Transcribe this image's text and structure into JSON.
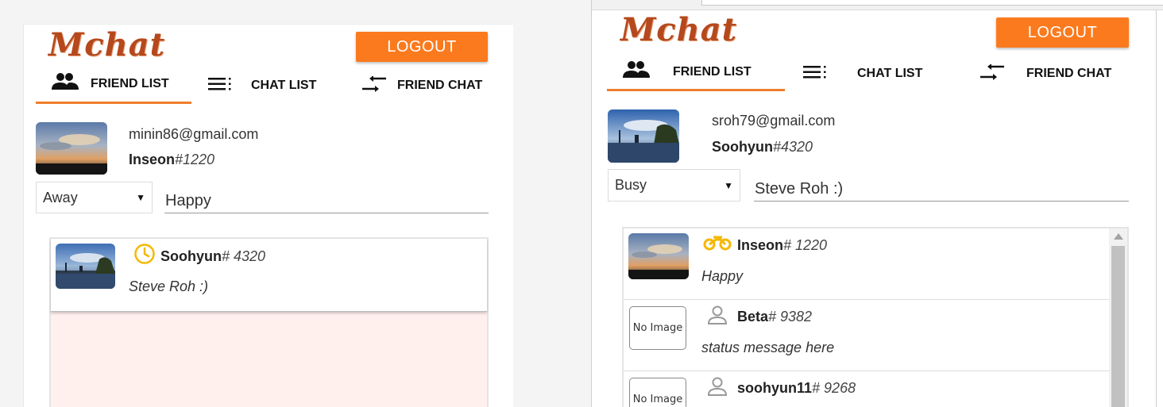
{
  "app": {
    "logo": "Mchat",
    "logout_label": "LOGOUT"
  },
  "tabs": [
    {
      "label": "FRIEND LIST",
      "icon": "people-icon"
    },
    {
      "label": "CHAT LIST",
      "icon": "list-icon"
    },
    {
      "label": "FRIEND CHAT",
      "icon": "swap-arrows-icon"
    }
  ],
  "colors": {
    "accent": "#fb7a1e",
    "tab_underline": "#ef7d2c",
    "logo": "#b5481c",
    "status_away": "#f5b800",
    "status_busy": "#f5b800",
    "offline": "#999999",
    "list_bg": "#fff0ee"
  },
  "left": {
    "profile": {
      "email": "minin86@gmail.com",
      "name": "Inseon",
      "tag": "#1220"
    },
    "status_select": "Away",
    "status_message": "Happy",
    "friends": [
      {
        "name": "Soohyun",
        "tag": "# 4320",
        "message": "Steve Roh :)",
        "status_icon": "clock-icon",
        "avatar": "photo"
      }
    ]
  },
  "right": {
    "profile": {
      "email": "sroh79@gmail.com",
      "name": "Soohyun",
      "tag": "#4320"
    },
    "status_select": "Busy",
    "status_message": "Steve Roh :)",
    "no_image_label": "No Image",
    "friends": [
      {
        "name": "Inseon",
        "tag": "# 1220",
        "message": "Happy",
        "status_icon": "motorcycle-icon",
        "avatar": "photo"
      },
      {
        "name": "Beta",
        "tag": "# 9382",
        "message": "status message here",
        "status_icon": "person-icon",
        "avatar": "none"
      },
      {
        "name": "soohyun11",
        "tag": "# 9268",
        "message": "",
        "status_icon": "person-icon",
        "avatar": "none"
      }
    ]
  }
}
